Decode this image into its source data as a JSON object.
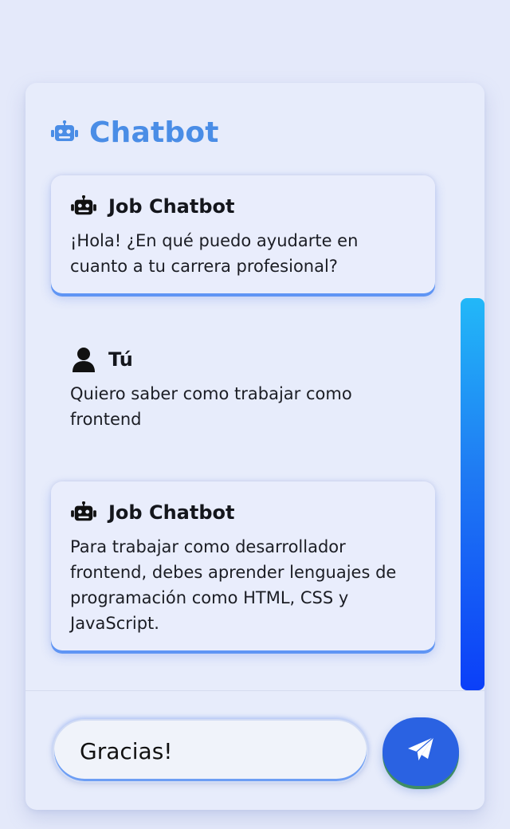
{
  "header": {
    "title": "Chatbot",
    "icon": "robot-icon"
  },
  "messages": [
    {
      "role": "bot",
      "author": "Job Chatbot",
      "icon": "robot-icon",
      "text": "¡Hola! ¿En qué puedo ayudarte en cuanto a tu carrera profesional?"
    },
    {
      "role": "user",
      "author": "Tú",
      "icon": "user-icon",
      "text": "Quiero saber como trabajar como frontend"
    },
    {
      "role": "bot",
      "author": "Job Chatbot",
      "icon": "robot-icon",
      "text": "Para trabajar como desarrollador frontend, debes aprender lenguajes de programación como HTML, CSS y JavaScript."
    }
  ],
  "composer": {
    "value": "Gracias!",
    "send_icon": "paper-plane-icon"
  },
  "colors": {
    "accent": "#4a8de6",
    "send_button": "#2a62e2",
    "scrollbar_top": "#22b8f8",
    "scrollbar_bottom": "#0b3ff8"
  }
}
